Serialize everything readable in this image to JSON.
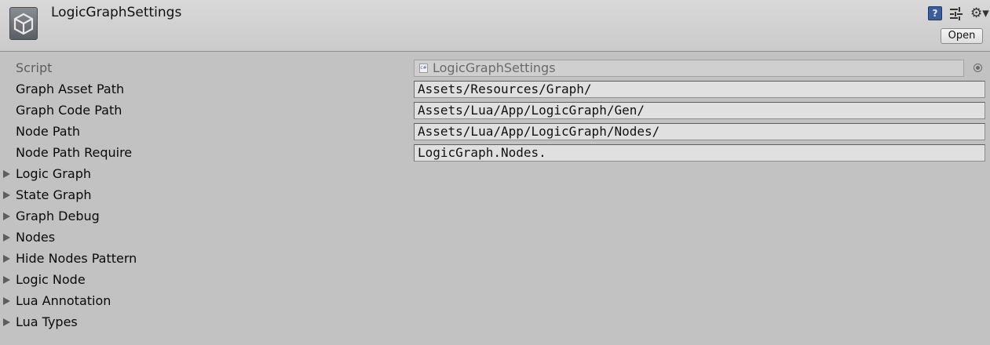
{
  "header": {
    "title": "LogicGraphSettings",
    "open_label": "Open",
    "icons": [
      "unity-logo-icon",
      "help-icon",
      "preset-icon",
      "gear-icon"
    ]
  },
  "properties": {
    "script_label": "Script",
    "script_value": "LogicGraphSettings",
    "graph_asset_path_label": "Graph Asset Path",
    "graph_asset_path_value": "Assets/Resources/Graph/",
    "graph_code_path_label": "Graph Code Path",
    "graph_code_path_value": "Assets/Lua/App/LogicGraph/Gen/",
    "node_path_label": "Node Path",
    "node_path_value": "Assets/Lua/App/LogicGraph/Nodes/",
    "node_path_require_label": "Node Path Require",
    "node_path_require_value": "LogicGraph.Nodes."
  },
  "foldouts": [
    "Logic Graph",
    "State Graph",
    "Graph Debug",
    "Nodes",
    "Hide Nodes Pattern",
    "Logic Node",
    "Lua Annotation",
    "Lua Types"
  ],
  "colors": {
    "background": "#c2c2c2",
    "header": "#d0d0d0",
    "field": "#e0e0e0"
  }
}
